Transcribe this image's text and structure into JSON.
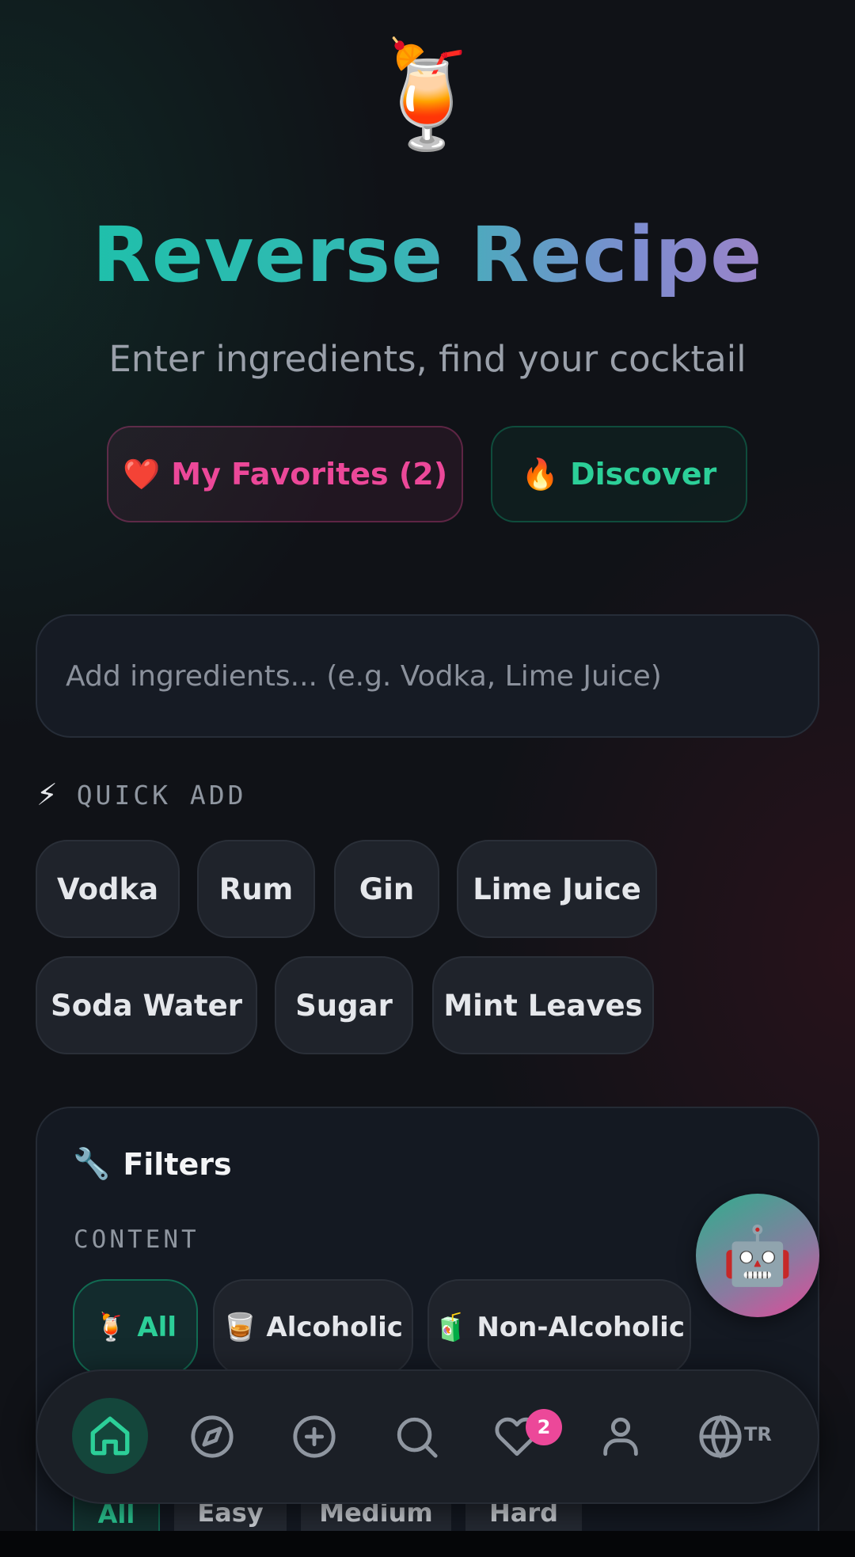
{
  "header": {
    "emoji": "🍹",
    "title": "Reverse Recipe",
    "subtitle": "Enter ingredients, find your cocktail"
  },
  "actions": {
    "favorites_icon": "❤️",
    "favorites_label": "My Favorites (2)",
    "discover_icon": "🔥",
    "discover_label": "Discover"
  },
  "search": {
    "value": "",
    "placeholder": "Add ingredients... (e.g. Vodka, Lime Juice)"
  },
  "quick_add": {
    "icon": "⚡",
    "label": "QUICK ADD",
    "items": [
      "Vodka",
      "Rum",
      "Gin",
      "Lime Juice",
      "Soda Water",
      "Sugar",
      "Mint Leaves"
    ]
  },
  "filters": {
    "icon": "🔧",
    "title": "Filters",
    "content_label": "CONTENT",
    "content_options": [
      {
        "icon": "🍹",
        "label": "All",
        "active": true
      },
      {
        "icon": "🥃",
        "label": "Alcoholic",
        "active": false
      },
      {
        "icon": "🧃",
        "label": "Non-Alcoholic",
        "active": false
      }
    ],
    "difficulty_options": [
      "All",
      "Easy",
      "Medium",
      "Hard"
    ],
    "difficulty_selected": "All"
  },
  "assistant": {
    "icon": "🤖"
  },
  "nav": {
    "items": [
      "home-icon",
      "compass-icon",
      "plus-circle-icon",
      "search-icon",
      "heart-icon",
      "user-icon",
      "globe-icon"
    ],
    "favorites_badge": "2",
    "language": "TR",
    "active": "home"
  },
  "colors": {
    "accent_green": "#2ccf98",
    "accent_pink": "#ec4899",
    "background": "#101217"
  }
}
